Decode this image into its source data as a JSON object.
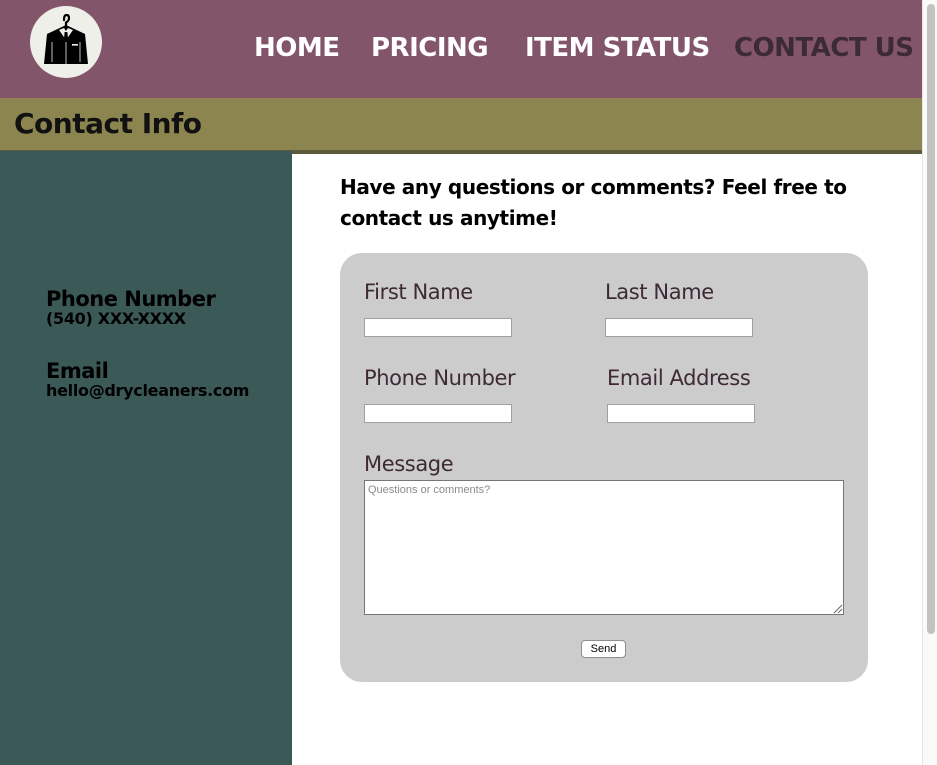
{
  "nav": {
    "home": "HOME",
    "pricing": "PRICING",
    "item_status": "ITEM STATUS",
    "contact": "CONTACT US",
    "logo_icon": "suit-hanger-icon"
  },
  "banner": {
    "title": "Contact Info"
  },
  "sidebar": {
    "phone_heading": "Phone Number",
    "phone_value": "(540) XXX-XXXX",
    "email_heading": "Email",
    "email_value": "hello@drycleaners.com"
  },
  "intro": "Have any questions or comments? Feel free to contact us anytime!",
  "form": {
    "first_name_label": "First Name",
    "first_name_value": "",
    "last_name_label": "Last Name",
    "last_name_value": "",
    "phone_label": "Phone Number",
    "phone_value": "",
    "email_label": "Email Address",
    "email_value": "",
    "message_label": "Message",
    "message_placeholder": "Questions or comments?",
    "send_label": "Send"
  },
  "colors": {
    "nav_bg": "#83556b",
    "nav_active": "#3c2a36",
    "banner_bg": "#8c8550",
    "sidebar_bg": "#3a5957",
    "form_bg": "#cccccc",
    "label_color": "#3e2a34"
  }
}
